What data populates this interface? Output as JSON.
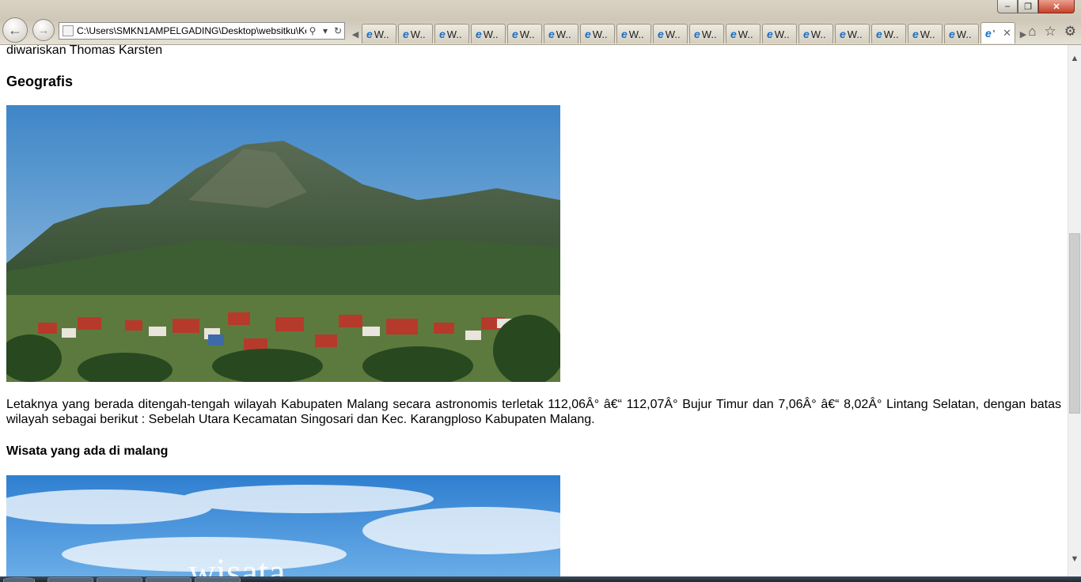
{
  "browser": {
    "address": "C:\\Users\\SMKN1AMPELGADING\\Desktop\\websitku\\Ke",
    "tabs": [
      "W..",
      "W..",
      "W..",
      "W..",
      "W..",
      "W..",
      "W..",
      "W..",
      "W..",
      "W..",
      "W..",
      "W..",
      "W..",
      "W..",
      "W..",
      "W..",
      "W..",
      "'"
    ],
    "active_tab_index": 17
  },
  "page": {
    "line1": "diwariskan Thomas Karsten",
    "heading_geografis": "Geografis",
    "paragraph": "Letaknya yang berada ditengah-tengah wilayah Kabupaten Malang secara astronomis terletak 112,06Â° â€“ 112,07Â° Bujur Timur dan 7,06Â° â€“ 8,02Â° Lintang Selatan, dengan batas wilayah sebagai berikut : Sebelah Utara Kecamatan Singosari dan Kec. Karangploso Kabupaten Malang.",
    "heading_wisata": "Wisata yang ada di malang",
    "photo2_text": "wisata"
  },
  "colors": {
    "sky_top": "#3f86c8",
    "sky_bottom": "#9cc6e4",
    "mountain": "#3f5a3a",
    "roof_red": "#b63a2b"
  }
}
